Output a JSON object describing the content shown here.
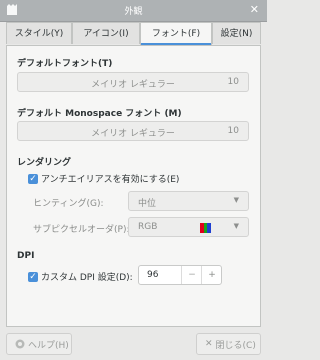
{
  "window": {
    "title": "外観",
    "close_glyph": "✕"
  },
  "tabs": [
    {
      "label": "スタイル(Y)"
    },
    {
      "label": "アイコン(I)"
    },
    {
      "label": "フォント(F)",
      "active": true
    },
    {
      "label": "設定(N)"
    }
  ],
  "fonts": {
    "default": {
      "heading": "デフォルトフォント(T)",
      "name": "メイリオ レギュラー",
      "size": "10"
    },
    "monospace": {
      "heading": "デフォルト Monospace フォント (M)",
      "name": "メイリオ レギュラー",
      "size": "10"
    }
  },
  "rendering": {
    "heading": "レンダリング",
    "antialias_label": "アンチエイリアスを有効にする(E)",
    "antialias_checked": true,
    "hinting_label": "ヒンティング(G):",
    "hinting_value": "中位",
    "subpixel_label": "サブピクセルオーダ(P):",
    "subpixel_value": "RGB",
    "subpixel_colors": [
      "#e0001b",
      "#1aa31a",
      "#1f3fd1"
    ]
  },
  "dpi": {
    "heading": "DPI",
    "custom_label": "カスタム DPI 設定(D):",
    "custom_checked": true,
    "value": "96",
    "minus": "−",
    "plus": "+"
  },
  "footer": {
    "help_label": "ヘルプ(H)",
    "close_label": "閉じる(C)"
  },
  "colors": {
    "accent": "#4a90d9",
    "titlebar": "#aeb2b4"
  }
}
